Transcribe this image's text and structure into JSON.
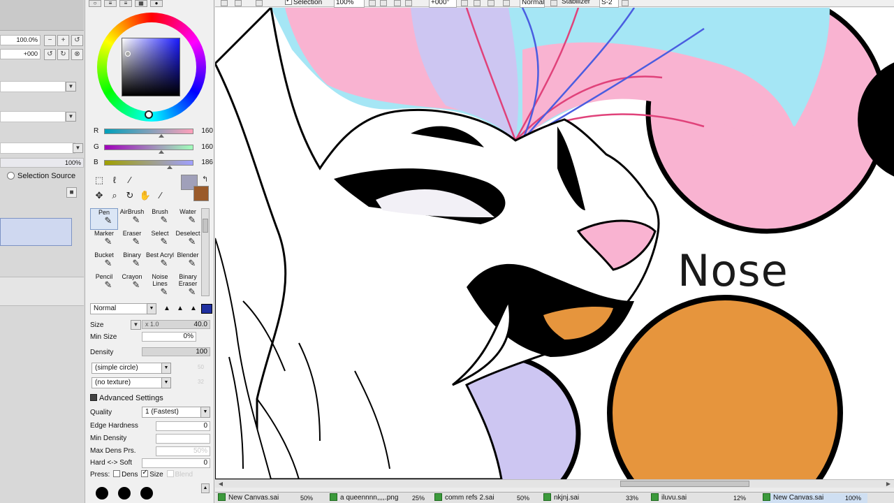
{
  "navigator": {
    "zoom": "100.0%",
    "angle": "+000",
    "opacity": "100%",
    "selection_source_label": "Selection Source"
  },
  "color": {
    "r_label": "R",
    "r_value": "160",
    "g_label": "G",
    "g_value": "160",
    "b_label": "B",
    "b_value": "186",
    "main_color": "#a0a0ba",
    "sub_color": "#9a5a2a"
  },
  "brushes": [
    {
      "label": "Pen",
      "icon": "pen-icon"
    },
    {
      "label": "AirBrush",
      "icon": "airbrush-icon"
    },
    {
      "label": "Brush",
      "icon": "brush-icon"
    },
    {
      "label": "Water",
      "icon": "water-icon"
    },
    {
      "label": "Marker",
      "icon": "marker-icon"
    },
    {
      "label": "Eraser",
      "icon": "eraser-icon"
    },
    {
      "label": "Select",
      "icon": "select-icon"
    },
    {
      "label": "Deselect",
      "icon": "deselect-icon"
    },
    {
      "label": "Bucket",
      "icon": "bucket-icon"
    },
    {
      "label": "Binary",
      "icon": "binary-icon"
    },
    {
      "label": "Best Acryl",
      "icon": "acryl-icon"
    },
    {
      "label": "Blender",
      "icon": "blender-icon"
    },
    {
      "label": "Pencil",
      "icon": "pencil-icon"
    },
    {
      "label": "Crayon",
      "icon": "crayon-icon"
    },
    {
      "label": "Noise Lines",
      "icon": "noise-icon"
    },
    {
      "label": "Binary Eraser",
      "icon": "binary-eraser-icon"
    }
  ],
  "brush_settings": {
    "blend_mode": "Normal",
    "size_label": "Size",
    "size_multiplier": "x 1.0",
    "size_value": "40.0",
    "min_size_label": "Min Size",
    "min_size_value": "0%",
    "density_label": "Density",
    "density_value": "100",
    "shape": "(simple circle)",
    "shape_value": "50",
    "texture": "(no texture)",
    "texture_value": "32",
    "advanced_label": "Advanced Settings",
    "quality_label": "Quality",
    "quality_value": "1 (Fastest)",
    "edge_hardness_label": "Edge Hardness",
    "edge_hardness_value": "0",
    "min_density_label": "Min Density",
    "max_dens_label": "Max Dens Prs.",
    "max_dens_value": "50%",
    "hard_soft_label": "Hard <-> Soft",
    "hard_soft_value": "0",
    "press_label": "Press:",
    "press_dens": "Dens",
    "press_size": "Size",
    "press_blend": "Blend",
    "dot_sizes": [
      "400",
      "450",
      "500"
    ]
  },
  "toolbar": {
    "selection_label": "Selection",
    "zoom": "100%",
    "angle": "+000°",
    "blend": "Normal",
    "stabilizer_label": "Stabilizer",
    "stabilizer_value": "S-2"
  },
  "canvas": {
    "nose_label": "Nose",
    "colors": {
      "pink": "#f9b3d1",
      "blue": "#a5e6f5",
      "lavender": "#cdc6f2",
      "orange": "#e6953d",
      "line": "#000000"
    }
  },
  "tabs": [
    {
      "name": "New Canvas.sai",
      "zoom": "50%"
    },
    {
      "name": "a queennnn,,,,.png",
      "zoom": "25%"
    },
    {
      "name": "comm refs 2.sai",
      "zoom": "50%"
    },
    {
      "name": "nkjnj.sai",
      "zoom": "33%"
    },
    {
      "name": "iluvu.sai",
      "zoom": "12%"
    },
    {
      "name": "New Canvas.sai",
      "zoom": "100%"
    }
  ]
}
